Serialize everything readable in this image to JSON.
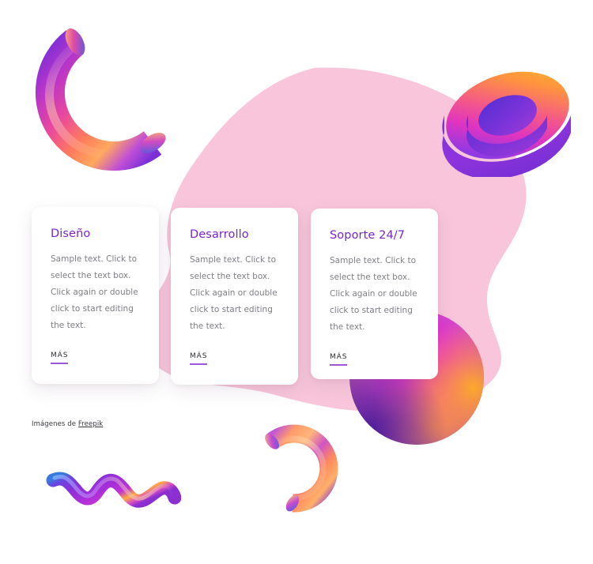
{
  "page": {
    "background_color": "#ffffff",
    "blob_color": "#f8c5da"
  },
  "cards": [
    {
      "id": "card-diseno",
      "title": "Diseño",
      "body": "Sample text. Click to select the text box. Click again or double click to start editing the text.",
      "link_label": "MÁS"
    },
    {
      "id": "card-desarrollo",
      "title": "Desarrollo",
      "body": "Sample text. Click to select the text box. Click again or double click to start editing the text.",
      "link_label": "MÁS"
    },
    {
      "id": "card-soporte",
      "title": "Soporte 24/7",
      "body": "Sample text. Click to select the text box. Click again or double click to start editing the text.",
      "link_label": "MÁS"
    }
  ],
  "credit": {
    "prefix": "Imágenes de ",
    "link_label": "Freepik"
  },
  "theme": {
    "title_color": "#7926c9",
    "body_color": "#7e7e85",
    "link_underline_color": "#9a58d6",
    "blob_pink": "#f8c5da"
  },
  "decorations": [
    {
      "name": "tube-top-left",
      "shape": "3d-c-tube",
      "colors": [
        "#8a2be2",
        "#e040c0",
        "#ff8a4c",
        "#ffd089"
      ]
    },
    {
      "name": "torus-top-right",
      "shape": "3d-ring",
      "colors": [
        "#ffb020",
        "#ff7ab0",
        "#c040e0",
        "#7a30d8",
        "#5a3ce8"
      ]
    },
    {
      "name": "sphere-right",
      "shape": "3d-sphere",
      "colors": [
        "#e820e8",
        "#ff9a30",
        "#7a2fd0"
      ]
    },
    {
      "name": "tube-bottom-center",
      "shape": "3d-c-tube",
      "colors": [
        "#a040e0",
        "#ff8a4c",
        "#ffd089"
      ]
    },
    {
      "name": "squiggle-bottom-left",
      "shape": "3d-wave",
      "colors": [
        "#3a7ae0",
        "#7a2fd0",
        "#c030e0",
        "#ffb84c"
      ]
    }
  ]
}
